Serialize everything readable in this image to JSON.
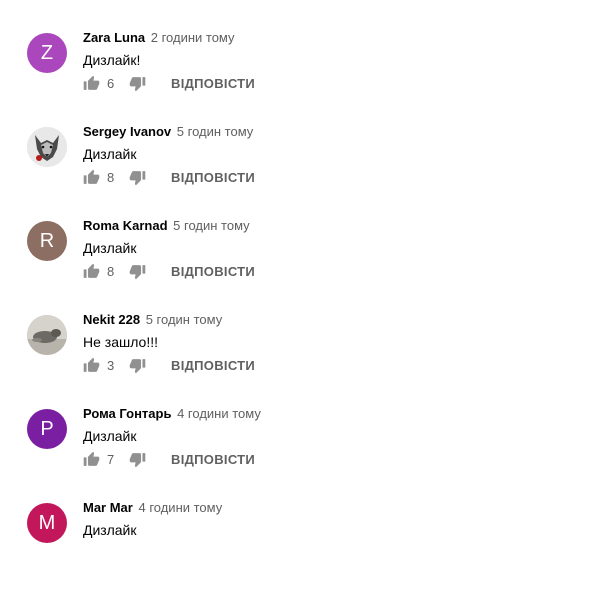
{
  "reply_label": "ВІДПОВІСТИ",
  "colors": {
    "text": "#030303",
    "secondary": "#606060",
    "icon": "#909090"
  },
  "comments": [
    {
      "author": "Zara Luna",
      "time": "2 години тому",
      "text": "Дизлайк!",
      "likes": "6",
      "avatar_letter": "Z",
      "avatar_color": "#ab47bc"
    },
    {
      "author": "Sergey Ivanov",
      "time": "5 годин тому",
      "text": "Дизлайк",
      "likes": "8",
      "avatar_letter": "",
      "avatar_color": "#dcdcdc"
    },
    {
      "author": "Roma Karnad",
      "time": "5 годин тому",
      "text": "Дизлайк",
      "likes": "8",
      "avatar_letter": "R",
      "avatar_color": "#8d6e63"
    },
    {
      "author": "Nekit 228",
      "time": "5 годин тому",
      "text": "Не зашло!!!",
      "likes": "3",
      "avatar_letter": "",
      "avatar_color": "#c8c8c8"
    },
    {
      "author": "Рома Гонтарь",
      "time": "4 години тому",
      "text": "Дизлайк",
      "likes": "7",
      "avatar_letter": "P",
      "avatar_color": "#7b1fa2"
    },
    {
      "author": "Mar Mar",
      "time": "4 години тому",
      "text": "Дизлайк",
      "likes": "",
      "avatar_letter": "M",
      "avatar_color": "#c2185b"
    }
  ]
}
